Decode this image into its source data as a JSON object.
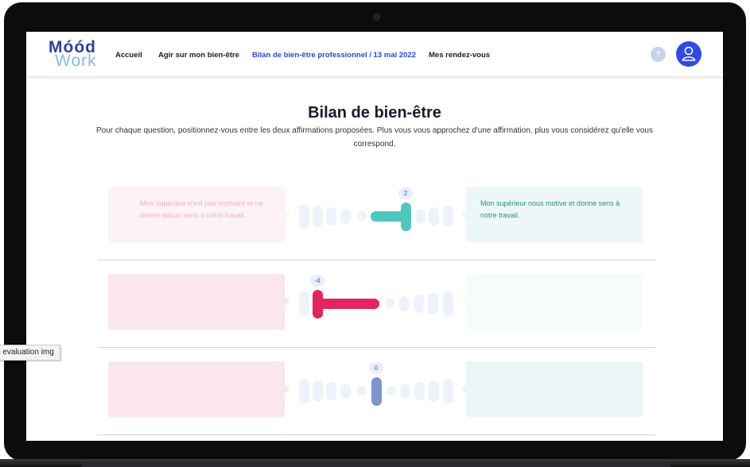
{
  "nav": {
    "logo_top": "Móód",
    "logo_bottom": "Work",
    "links": [
      {
        "label": "Accueil"
      },
      {
        "label": "Agir sur mon bien-être"
      },
      {
        "label": "Bilan de bien-être professionnel / 13 mai 2022"
      },
      {
        "label": "Mes rendez-vous"
      }
    ],
    "help_label": "?"
  },
  "page": {
    "title": "Bilan de bien-être",
    "description": "Pour chaque question, positionnez-vous entre les deux affirmations proposées. Plus vous vous approchez d'une affirmation, plus vous considérez qu'elle vous correspond."
  },
  "questions": [
    {
      "left": "Mon supérieur n'est pas motivant et ne donne aucun sens à notre travail.",
      "right": "Mon supérieur nous motive et donne sens à notre travail.",
      "value": "2",
      "color": "#4fc7bd"
    },
    {
      "left": "",
      "right": "",
      "value": "-4",
      "color": "#e5245f"
    },
    {
      "left": "",
      "right": "",
      "value": "0",
      "color": "#7f94cf"
    }
  ],
  "tooltip": "o evaluation img"
}
